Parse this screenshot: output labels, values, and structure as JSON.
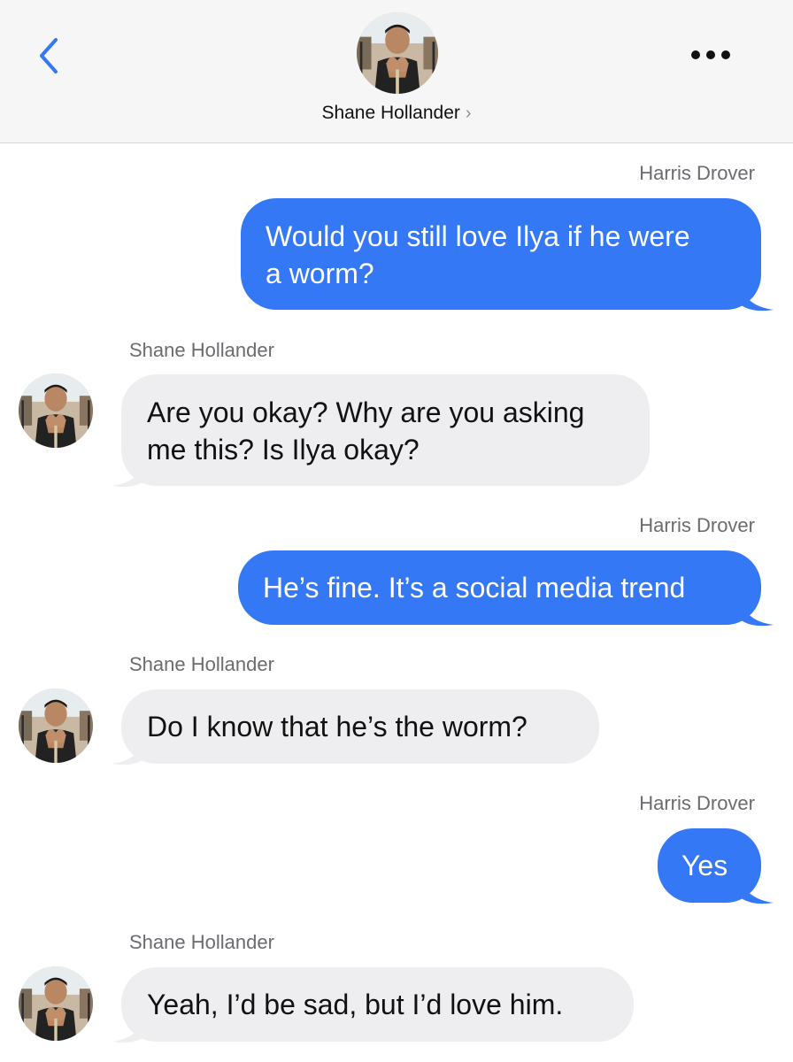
{
  "header": {
    "contact_name": "Shane Hollander",
    "chevron": "›",
    "back_icon": "chevron-left-icon",
    "more_icon": "ellipsis-icon",
    "accent": "#3478f6"
  },
  "colors": {
    "outgoing_bubble": "#3478f6",
    "incoming_bubble": "#eeeef0",
    "header_bg": "#f6f6f6"
  },
  "messages": [
    {
      "direction": "outgoing",
      "sender": "Harris Drover",
      "lines": [
        "Would you still love Ilya if he were",
        "a worm?"
      ]
    },
    {
      "direction": "incoming",
      "sender": "Shane Hollander",
      "lines": [
        "Are you okay? Why are you asking",
        "me this? Is Ilya okay?"
      ]
    },
    {
      "direction": "outgoing",
      "sender": "Harris Drover",
      "lines": [
        "He’s fine. It’s a social media trend"
      ]
    },
    {
      "direction": "incoming",
      "sender": "Shane Hollander",
      "lines": [
        "Do I know that he’s the worm?"
      ]
    },
    {
      "direction": "outgoing",
      "sender": "Harris Drover",
      "lines": [
        "Yes"
      ]
    },
    {
      "direction": "incoming",
      "sender": "Shane Hollander",
      "lines": [
        "Yeah, I’d be sad, but I’d love him."
      ]
    }
  ]
}
